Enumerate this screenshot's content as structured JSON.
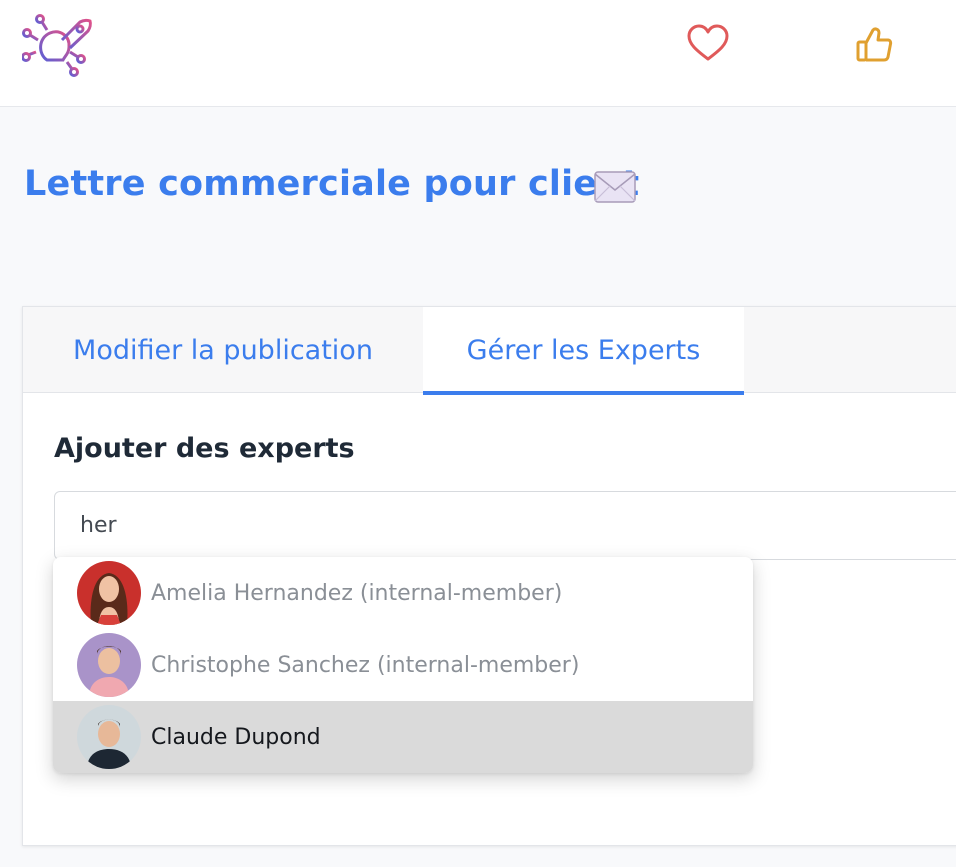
{
  "header": {
    "logo_icon": "lightbulb-rocket-logo",
    "favorite_icon": "heart-icon",
    "like_icon": "thumbs-up-icon"
  },
  "page": {
    "title": "Lettre commerciale pour client",
    "title_emoji_icon": "envelope-icon"
  },
  "tabs": [
    {
      "label": "Modifier la publication",
      "active": false
    },
    {
      "label": "Gérer les Experts",
      "active": true
    }
  ],
  "experts": {
    "section_title": "Ajouter des experts",
    "search_value": "her",
    "suggestions": [
      {
        "label": "Amelia Hernandez (internal-member)",
        "highlighted": false
      },
      {
        "label": "Christophe Sanchez (internal-member)",
        "highlighted": false
      },
      {
        "label": "Claude Dupond",
        "highlighted": true
      }
    ]
  },
  "colors": {
    "accent": "#3b7ded",
    "heart": "#e05a5a",
    "thumb": "#e0a030",
    "highlight_row": "#dadada"
  }
}
